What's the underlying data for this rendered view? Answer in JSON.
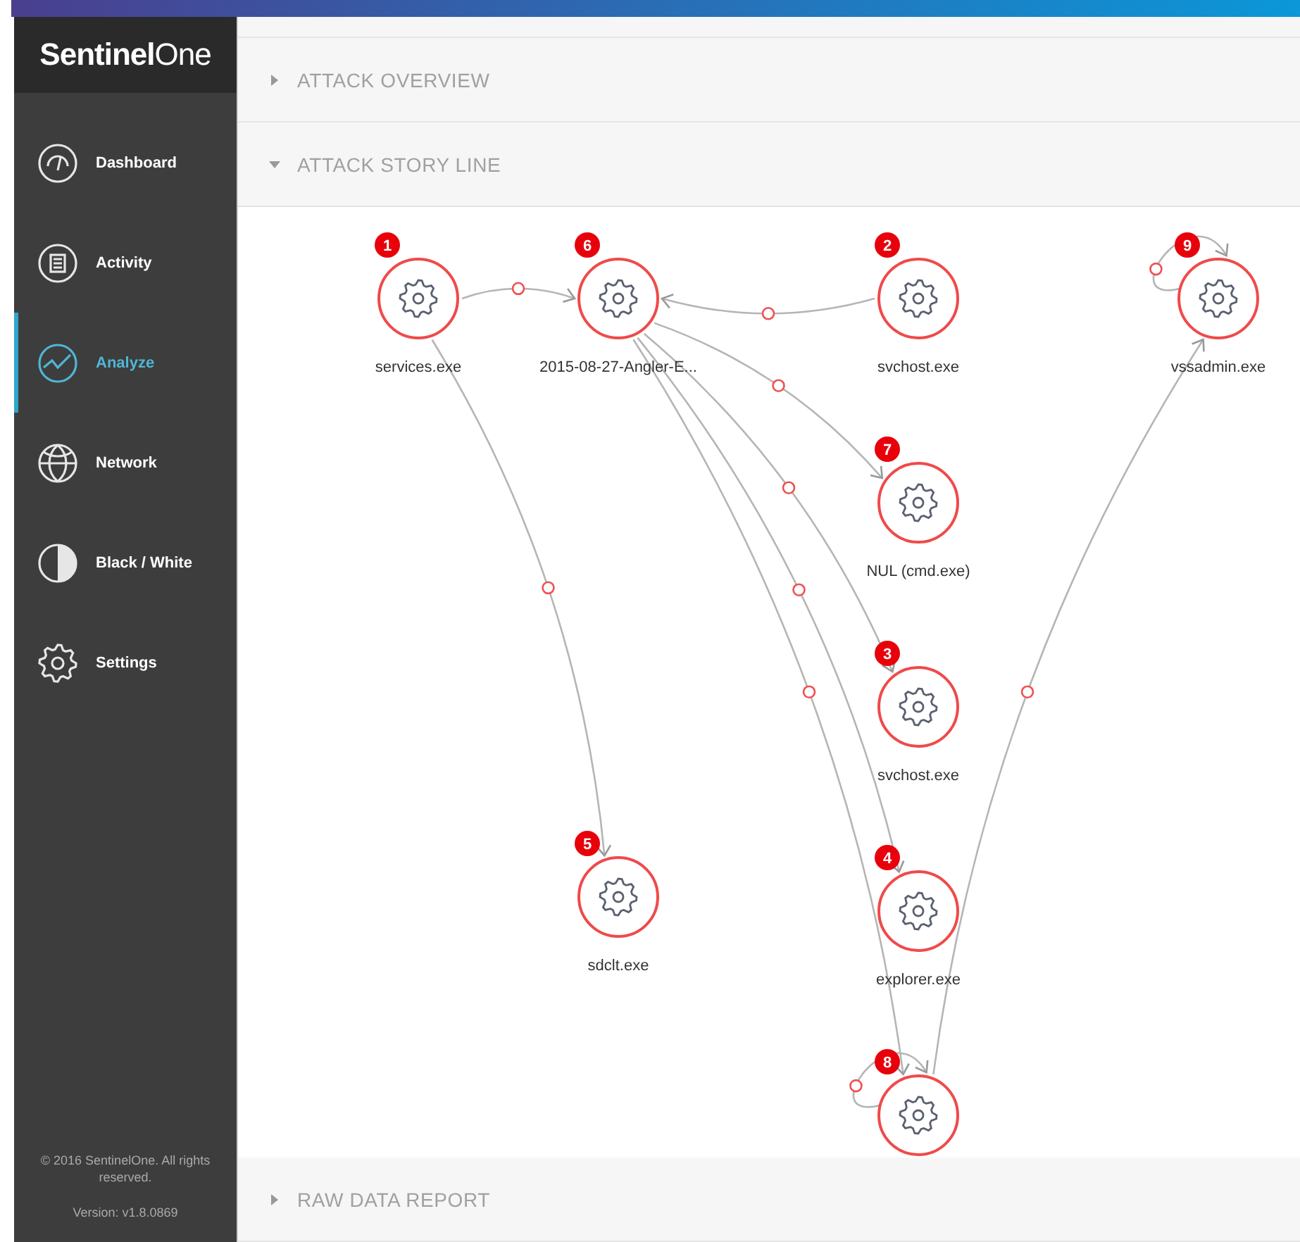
{
  "sidebar": {
    "logo": "**Sentinel**One",
    "items": [
      {
        "label": "Dashboard",
        "selected": false
      },
      {
        "label": "Activity",
        "selected": false
      },
      {
        "label": "Analyze",
        "selected": true
      },
      {
        "label": "Network",
        "selected": false
      },
      {
        "label": "Black / White",
        "selected": false
      },
      {
        "label": "Settings",
        "selected": false
      }
    ],
    "copyright": "© 2016 SentinelOne. All rights reserved.",
    "version": "Version: v1.8.0869"
  },
  "sections": [
    {
      "title": "ATTACK OVERVIEW",
      "expanded": false
    },
    {
      "title": "ATTACK STORY LINE",
      "expanded": true,
      "graph": {
        "nodes": [
          {
            "number": "1",
            "label": "services.exe"
          },
          {
            "number": "6",
            "label": "2015-08-27-Angler-E..."
          },
          {
            "number": "2",
            "label": "svchost.exe"
          },
          {
            "number": "9",
            "label": "vssadmin.exe"
          },
          {
            "number": "7",
            "label": "NUL (cmd.exe)"
          },
          {
            "number": "3",
            "label": "svchost.exe"
          },
          {
            "number": "5",
            "label": "sdclt.exe"
          },
          {
            "number": "4",
            "label": "explorer.exe"
          },
          {
            "number": "8"
          }
        ]
      }
    },
    {
      "title": "RAW DATA REPORT",
      "expanded": false
    }
  ]
}
